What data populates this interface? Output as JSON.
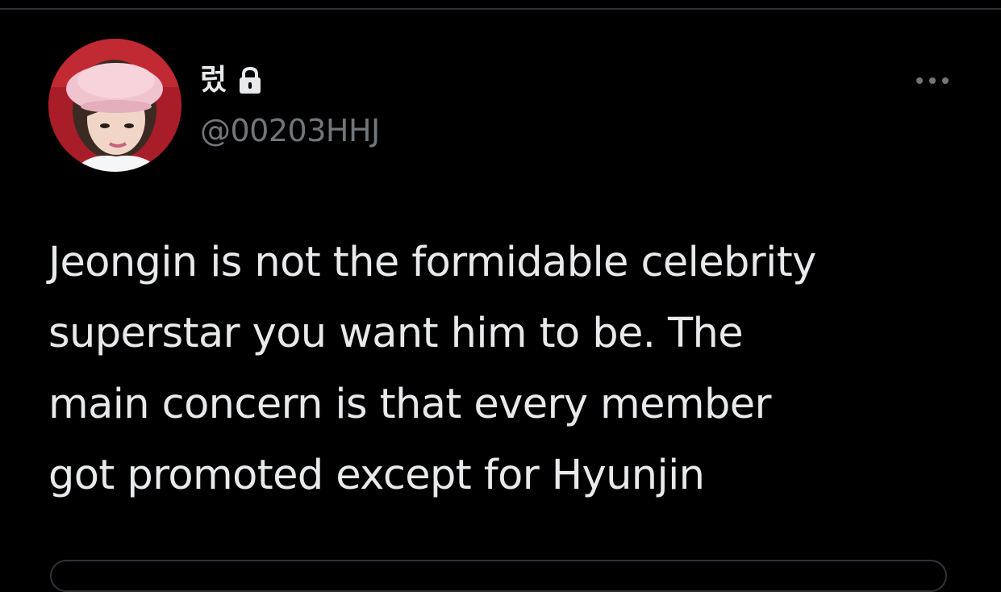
{
  "tweet": {
    "display_name": "렀",
    "handle": "@00203HHJ",
    "text": "Jeongin is not the formidable celebrity\nsuperstar you want him to be. The\nmain concern is that every member\ngot promoted except for Hyunjin",
    "protected": true
  },
  "icons": {
    "lock": "lock-icon",
    "more": "more-options-icon"
  },
  "colors": {
    "background": "#000000",
    "primary_text": "#e7e9ea",
    "secondary_text": "#71767b",
    "divider": "#2f3336"
  }
}
